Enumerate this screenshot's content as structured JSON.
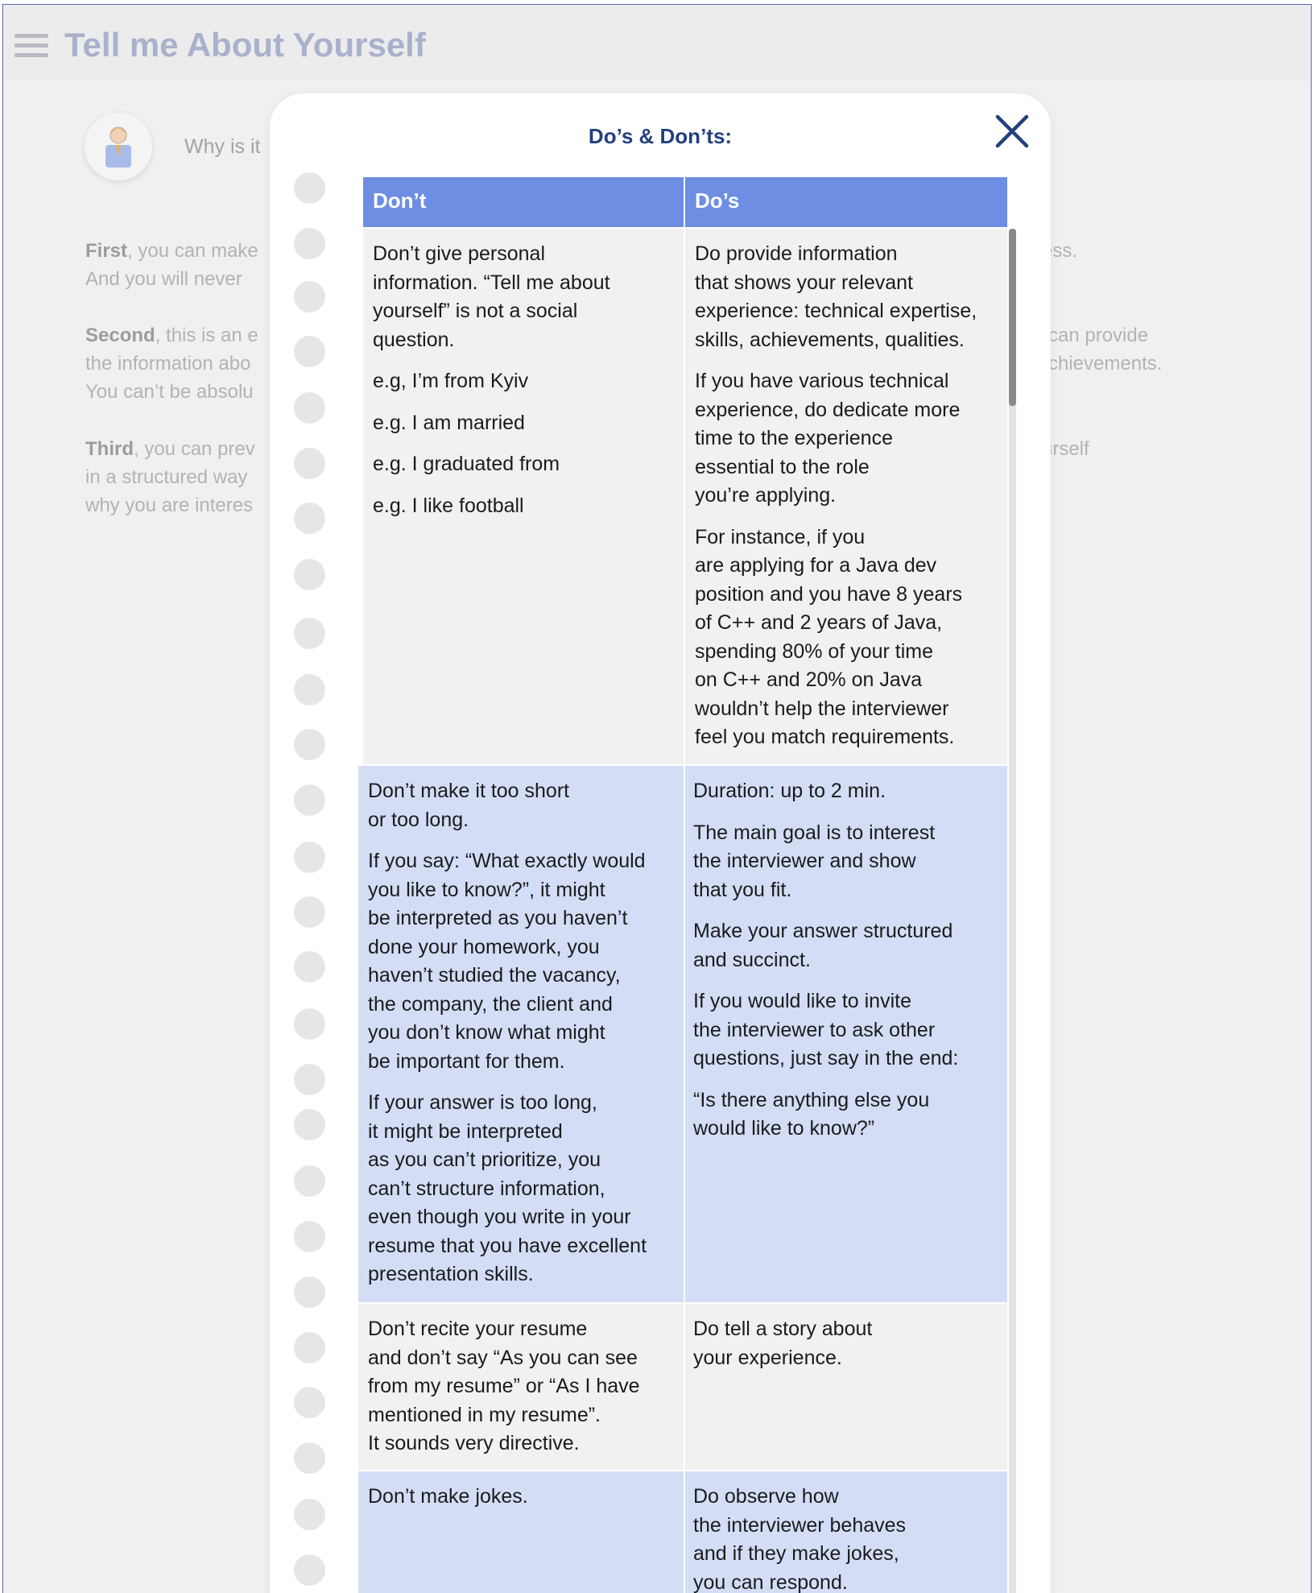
{
  "app": {
    "title": "Tell me About Yourself"
  },
  "background": {
    "question": "Why is it",
    "p1_bold": "First",
    "p1_line1": ", you can make",
    "p1_line2": "And you will never",
    "p1_right": "ess.",
    "p2_bold": "Second",
    "p2_line1": ", this is an e",
    "p2_line2": "the information abo",
    "p2_line3": "You can’t be absolu",
    "p2_right1": "can provide",
    "p2_right2": "chievements.",
    "p3_bold": "Third",
    "p3_line1": ", you can prev",
    "p3_line2": "in a structured way",
    "p3_line3": "why you are interes",
    "p3_right": "urself"
  },
  "modal": {
    "title": "Do’s & Don’ts:",
    "close_icon": "close-icon",
    "headers": {
      "dont": "Don’t",
      "do": "Do’s"
    },
    "rows": [
      {
        "dont": [
          "Don’t give personal\ninformation. “Tell me about\nyourself” is not a social\nquestion.",
          "e.g, I’m from Kyiv",
          "e.g. I am married",
          "e.g. I graduated from",
          "e.g. I like football"
        ],
        "do": [
          "Do provide information\nthat shows your relevant\nexperience: technical expertise,\nskills, achievements, qualities.",
          "If you have various technical\nexperience, do dedicate more\ntime to the experience\nessential to the role\nyou’re applying.",
          "For instance, if you\nare applying for a Java dev\nposition and you have 8 years\nof C++ and 2 years of Java,\nspending 80% of your time\non C++ and 20% on Java\nwouldn’t help the interviewer\nfeel you match requirements."
        ]
      },
      {
        "dont": [
          "Don’t make it too short\nor too long.",
          "If you say: “What exactly would\nyou like to know?”, it might\nbe interpreted as you haven’t\ndone your homework, you\nhaven’t studied the vacancy,\nthe company, the client and\nyou don’t know what might\nbe important for them.",
          "If your answer is too long,\nit might be interpreted\nas you can’t prioritize, you\ncan’t structure information,\neven though you write in your\nresume that you have excellent\npresentation skills."
        ],
        "do": [
          "Duration: up to 2 min.",
          "The main goal is to interest\nthe interviewer and show\nthat you fit.",
          "Make your answer structured\nand succinct.",
          "If you would like to invite\nthe interviewer to ask other\nquestions, just say in the end:",
          "“Is there anything else you\nwould like to know?”"
        ]
      },
      {
        "dont": [
          "Don’t recite your resume\nand don’t say “As you can see\nfrom my resume” or “As I have\nmentioned in my resume”.\nIt sounds very directive."
        ],
        "do": [
          "Do tell a story about\nyour experience."
        ]
      },
      {
        "dont": [
          "Don’t make jokes."
        ],
        "do": [
          "Do observe how\nthe interviewer behaves\nand if they make jokes,\nyou can respond."
        ]
      }
    ]
  },
  "colors": {
    "header": "#6e8ee4",
    "row_grey": "#f1f1f1",
    "row_blue": "#d3ddf6",
    "title": "#23407e"
  }
}
